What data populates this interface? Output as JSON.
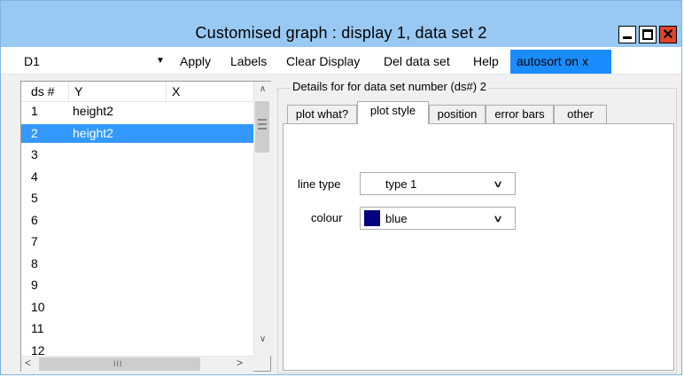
{
  "window": {
    "title": "Customised graph : display 1, data set 2"
  },
  "toolbar": {
    "display_value": "D1",
    "apply": "Apply",
    "labels": "Labels",
    "clear_display": "Clear Display",
    "del_data_set": "Del data set",
    "help": "Help",
    "autosort": "autosort on x"
  },
  "list": {
    "columns": [
      "ds #",
      "Y",
      "X"
    ],
    "rows": [
      {
        "ds": "1",
        "y": "height2"
      },
      {
        "ds": "2",
        "y": "height2",
        "selected": true
      },
      {
        "ds": "3",
        "y": ""
      },
      {
        "ds": "4",
        "y": ""
      },
      {
        "ds": "5",
        "y": ""
      },
      {
        "ds": "6",
        "y": ""
      },
      {
        "ds": "7",
        "y": ""
      },
      {
        "ds": "8",
        "y": ""
      },
      {
        "ds": "9",
        "y": ""
      },
      {
        "ds": "10",
        "y": ""
      },
      {
        "ds": "11",
        "y": ""
      },
      {
        "ds": "12",
        "y": ""
      }
    ]
  },
  "details": {
    "group_label": "Details for for data set number (ds#) 2",
    "tabs": [
      "plot what?",
      "plot style",
      "position",
      "error bars",
      "other"
    ],
    "active_tab": "plot style",
    "line_type_label": "line type",
    "line_type_value": "type 1",
    "colour_label": "colour",
    "colour_value": "blue",
    "colour_hex": "#000080"
  },
  "colors": {
    "title_bar": "#99c9f3",
    "selection": "#3399ff",
    "autosort_bg": "#1a8cff",
    "close_button": "#e0442d"
  }
}
